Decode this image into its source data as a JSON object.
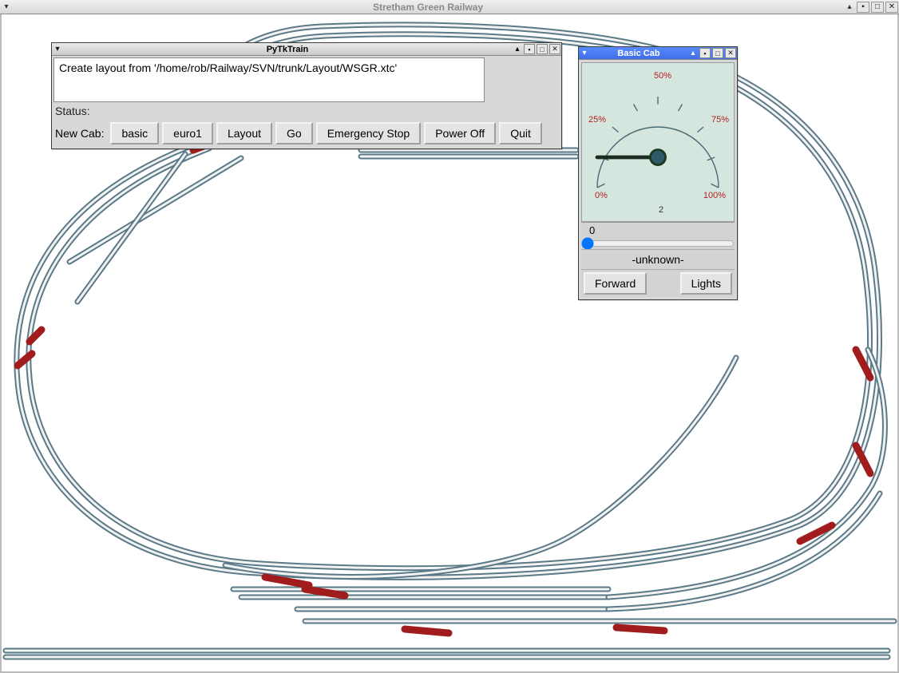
{
  "app": {
    "title": "Stretham Green Railway"
  },
  "pytk": {
    "title": "PyTkTrain",
    "log_text": "Create layout from '/home/rob/Railway/SVN/trunk/Layout/WSGR.xtc'",
    "status_label": "Status:",
    "newcab_label": "New Cab:",
    "buttons": {
      "basic": "basic",
      "euro1": "euro1",
      "layout": "Layout",
      "go": "Go",
      "estop": "Emergency Stop",
      "poweroff": "Power Off",
      "quit": "Quit"
    }
  },
  "cab": {
    "title": "Basic Cab",
    "gauge": {
      "ticks": {
        "p0": "0%",
        "p25": "25%",
        "p50": "50%",
        "p75": "75%",
        "p100": "100%"
      },
      "address": "2",
      "needle_value": 0
    },
    "slider": {
      "value": "0"
    },
    "loco_name": "-unknown-",
    "buttons": {
      "forward": "Forward",
      "lights": "Lights"
    }
  },
  "colors": {
    "rail": "#5b7a88",
    "rail_inner": "#f2f2f2",
    "turnout": "#a11c1c",
    "cab_title_active": "#3f6ee8",
    "gauge_bg": "#d5e6de",
    "gauge_text": "#b02020"
  }
}
